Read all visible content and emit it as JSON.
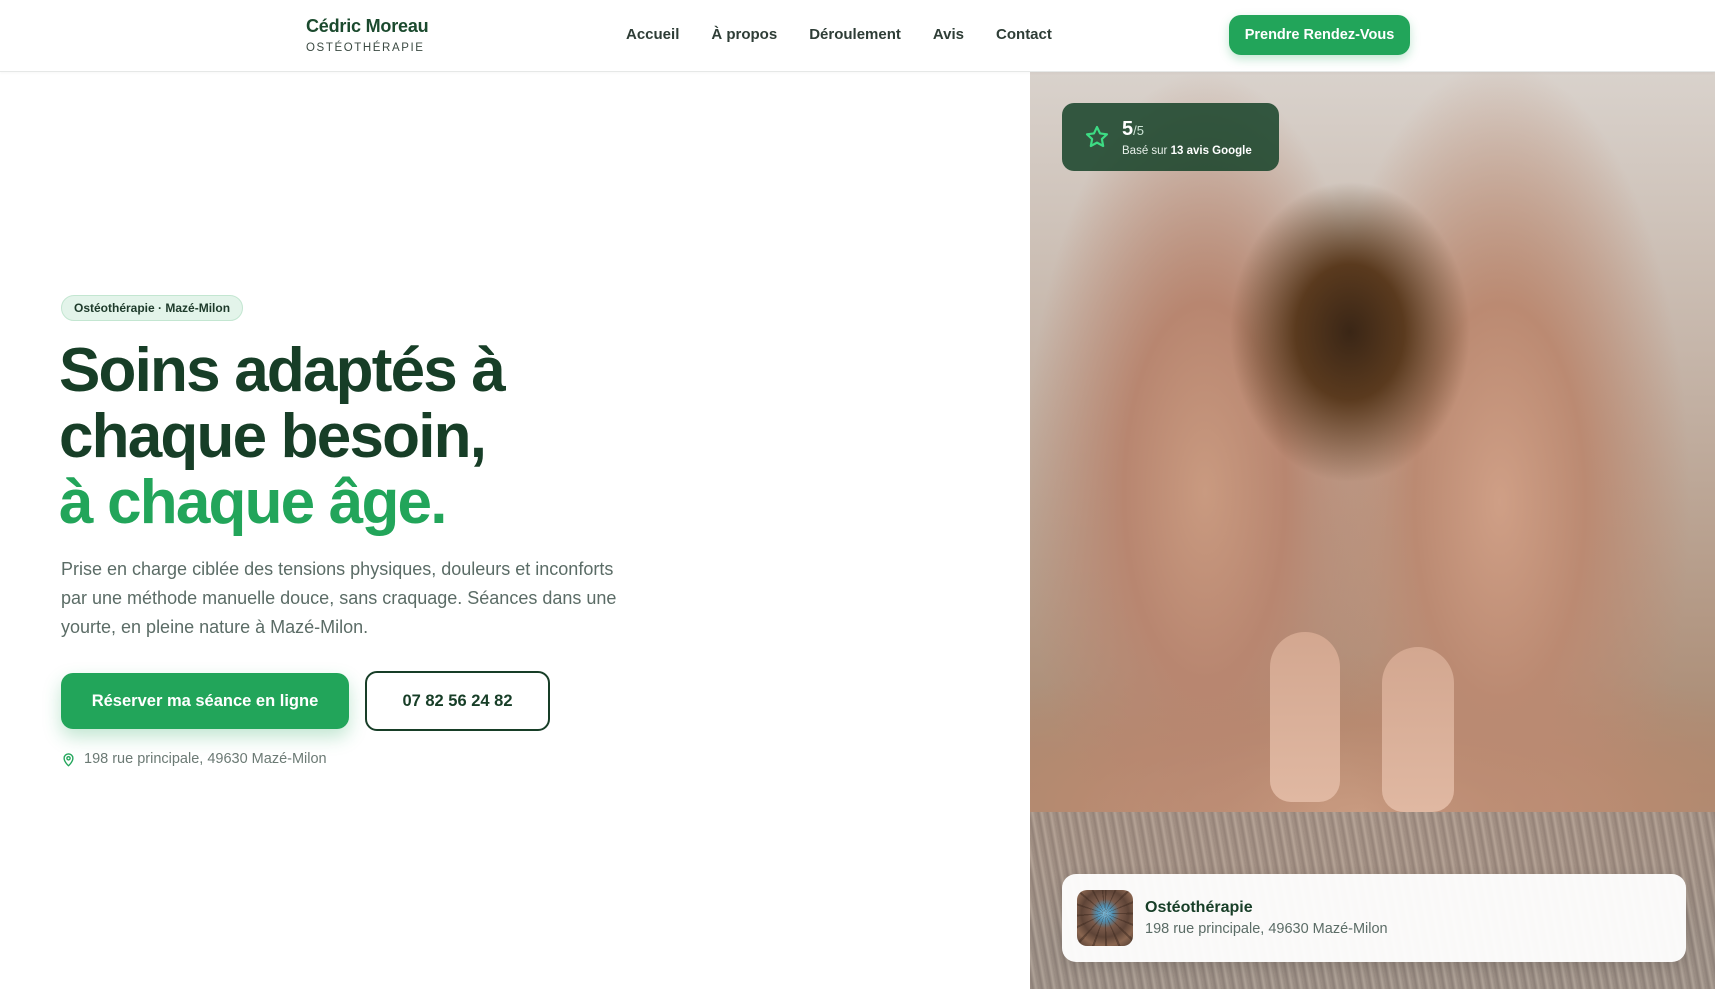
{
  "brand": {
    "name": "Cédric Moreau",
    "subtitle": "OSTÉOTHÉRAPIE"
  },
  "nav": {
    "items": [
      {
        "label": "Accueil"
      },
      {
        "label": "À propos"
      },
      {
        "label": "Déroulement"
      },
      {
        "label": "Avis"
      },
      {
        "label": "Contact"
      }
    ]
  },
  "header_cta": {
    "label": "Prendre Rendez-Vous"
  },
  "hero": {
    "tag": "Ostéothérapie · Mazé-Milon",
    "title_line1": "Soins adaptés à",
    "title_line2": "chaque besoin,",
    "title_line3": "à chaque âge.",
    "description": "Prise en charge ciblée des tensions physiques, douleurs et inconforts par une méthode manuelle douce, sans craquage. Séances dans une yourte, en pleine nature à Mazé-Milon.",
    "primary_button": "Réserver ma séance en ligne",
    "phone_button": "07 82 56 24 82",
    "address": "198 rue principale, 49630 Mazé-Milon"
  },
  "rating": {
    "score": "5",
    "out_of": "/5",
    "based_on": "Basé sur",
    "reviews": "13 avis Google"
  },
  "location_card": {
    "title": "Ostéothérapie",
    "address": "198 rue principale, 49630 Mazé-Milon"
  },
  "colors": {
    "accent": "#22a55a",
    "dark_green": "#173e27",
    "tag_bg": "#e3f4ea"
  },
  "icons": [
    "star-icon",
    "map-pin-icon"
  ]
}
